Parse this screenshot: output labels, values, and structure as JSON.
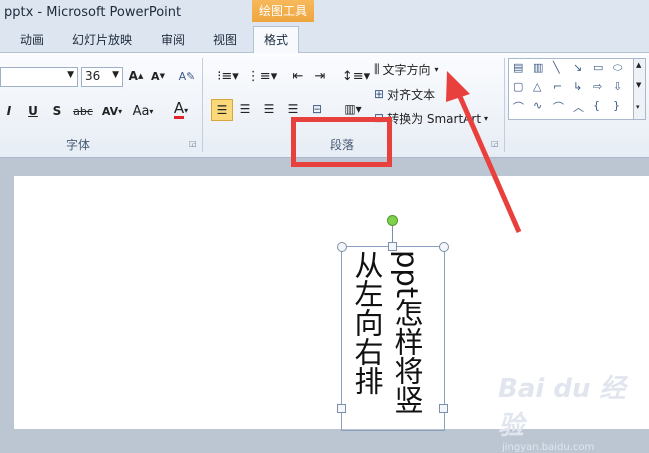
{
  "window": {
    "title": "pptx - Microsoft PowerPoint",
    "contextual_tab_group": "绘图工具"
  },
  "tabs": [
    {
      "label": "动画"
    },
    {
      "label": "幻灯片放映"
    },
    {
      "label": "审阅"
    },
    {
      "label": "视图"
    },
    {
      "label": "格式",
      "active": true
    }
  ],
  "font_group": {
    "label": "字体",
    "font_size": "36",
    "grow_font": "A",
    "shrink_font": "A",
    "italic": "I",
    "underline": "U",
    "shadow": "S",
    "strikethrough": "abc",
    "char_spacing": "AV",
    "change_case": "Aa",
    "font_color": "A"
  },
  "paragraph_group": {
    "label": "段落",
    "text_direction": "文字方向",
    "align_text": "对齐文本",
    "convert_smartart": "转换为 SmartArt"
  },
  "slide": {
    "text_line1": "ppt怎样将竖",
    "text_line2": "从左向右排"
  },
  "watermark": {
    "brand": "Bai du 经验",
    "url": "jingyan.baidu.com"
  },
  "colors": {
    "annotation_red": "#e8403d",
    "selected_button": "#fbd97a",
    "contextual_tab": "#f0a843"
  }
}
